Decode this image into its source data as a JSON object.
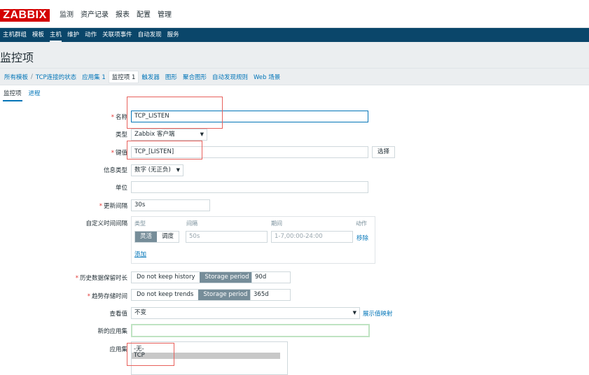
{
  "header": {
    "logo": "ZABBIX",
    "menu": [
      "监测",
      "资产记录",
      "报表",
      "配置",
      "管理"
    ],
    "active_menu": "配置"
  },
  "subnav": {
    "items": [
      "主机群组",
      "模板",
      "主机",
      "维护",
      "动作",
      "关联项事件",
      "自动发现",
      "服务"
    ],
    "active": "主机"
  },
  "page_title": "监控项",
  "breadcrumbs": {
    "all_templates": "所有模板",
    "separator": "/",
    "template": "TCP连接的状态",
    "applications": "应用集 1",
    "items": "监控项 1",
    "triggers": "触发器",
    "graphs": "图形",
    "screens": "聚合图形",
    "discovery": "自动发现规则",
    "web": "Web 场景"
  },
  "tabs": [
    "监控项",
    "进程"
  ],
  "form": {
    "required_mark": "*",
    "name_label": "名称",
    "name_value": "TCP_LISTEN",
    "type_label": "类型",
    "type_value": "Zabbix 客户端",
    "key_label": "键值",
    "key_value": "TCP_[LISTEN]",
    "select_button": "选择",
    "info_type_label": "信息类型",
    "info_type_value": "数字 (无正负)",
    "units_label": "单位",
    "units_value": "",
    "interval_label": "更新间隔",
    "interval_value": "30s",
    "custom_intervals_label": "自定义时间间隔",
    "custom_intervals": {
      "col_type": "类型",
      "col_interval": "间隔",
      "col_period": "期间",
      "col_action": "动作",
      "flexible": "灵活",
      "scheduling": "调度",
      "interval_placeholder": "50s",
      "period_placeholder": "1-7,00:00-24:00",
      "remove": "移除",
      "add": "添加"
    },
    "history_label": "历史数据保留时长",
    "history_no_keep": "Do not keep history",
    "history_storage": "Storage period",
    "history_value": "90d",
    "trends_label": "趋势存储时间",
    "trends_no_keep": "Do not keep trends",
    "trends_storage": "Storage period",
    "trends_value": "365d",
    "show_value_label": "查看值",
    "show_value_value": "不变",
    "show_value_link": "展示值映射",
    "new_app_label": "新的应用集",
    "new_app_value": "",
    "apps_label": "应用集",
    "apps_options": [
      "-无-",
      "TCP"
    ]
  },
  "colors": {
    "nav_bg": "#0a466a",
    "logo_bg": "#d40000",
    "link": "#0275b8",
    "annotation": "#e8615c"
  }
}
